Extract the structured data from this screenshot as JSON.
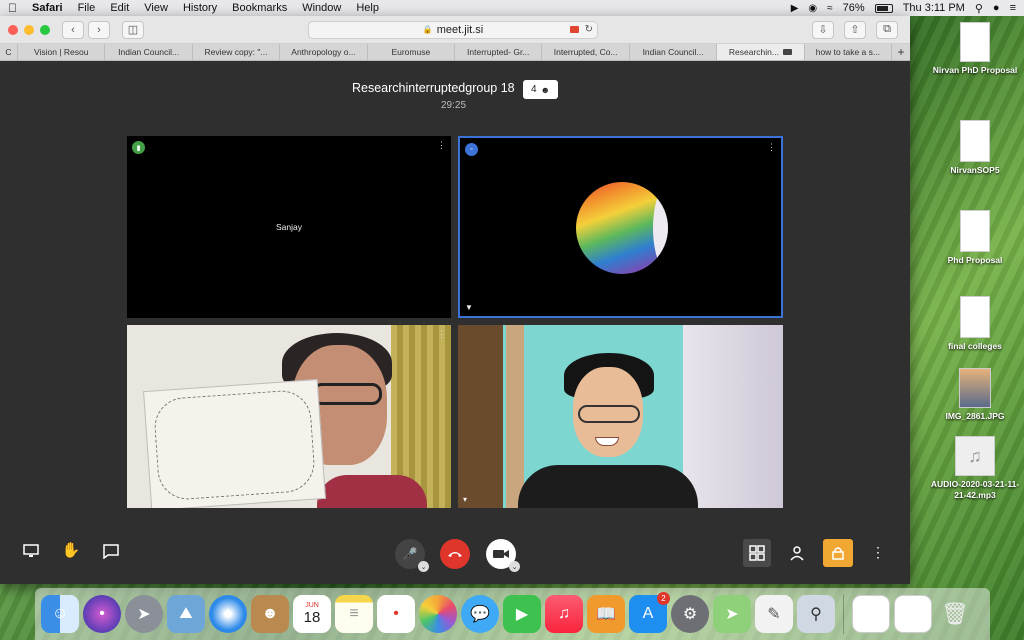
{
  "menubar": {
    "app": "Safari",
    "items": [
      "File",
      "Edit",
      "View",
      "History",
      "Bookmarks",
      "Window",
      "Help"
    ],
    "battery": "76%",
    "clock": "Thu 3:11 PM"
  },
  "browser": {
    "url": "meet.jit.si",
    "tabs": [
      {
        "label": "C"
      },
      {
        "label": "Vision | Resou"
      },
      {
        "label": "Indian Council..."
      },
      {
        "label": "Review copy: \"..."
      },
      {
        "label": "Anthropology o..."
      },
      {
        "label": "Euromuse"
      },
      {
        "label": "Interrupted- Gr..."
      },
      {
        "label": "Interrupted, Co..."
      },
      {
        "label": "Indian Council..."
      },
      {
        "label": "Researchin..."
      },
      {
        "label": "how to take a s..."
      }
    ],
    "new_tab": "+"
  },
  "meeting": {
    "room_name": "Researchinterruptedgroup 18",
    "participant_count": "4",
    "timer": "29:25",
    "tiles": [
      {
        "name": "Sanjay"
      }
    ]
  },
  "desktop": {
    "items": [
      {
        "label": "Nirvan PhD Proposal"
      },
      {
        "label": "NirvanSOP5"
      },
      {
        "label": "Phd Proposal"
      },
      {
        "label": "final colleges"
      },
      {
        "label": "IMG_2861.JPG"
      },
      {
        "label": "AUDIO-2020-03-21-11-21-42.mp3"
      }
    ]
  },
  "dock": {
    "calendar_month": "JUN",
    "calendar_day": "18",
    "appstore_badge": "2"
  }
}
